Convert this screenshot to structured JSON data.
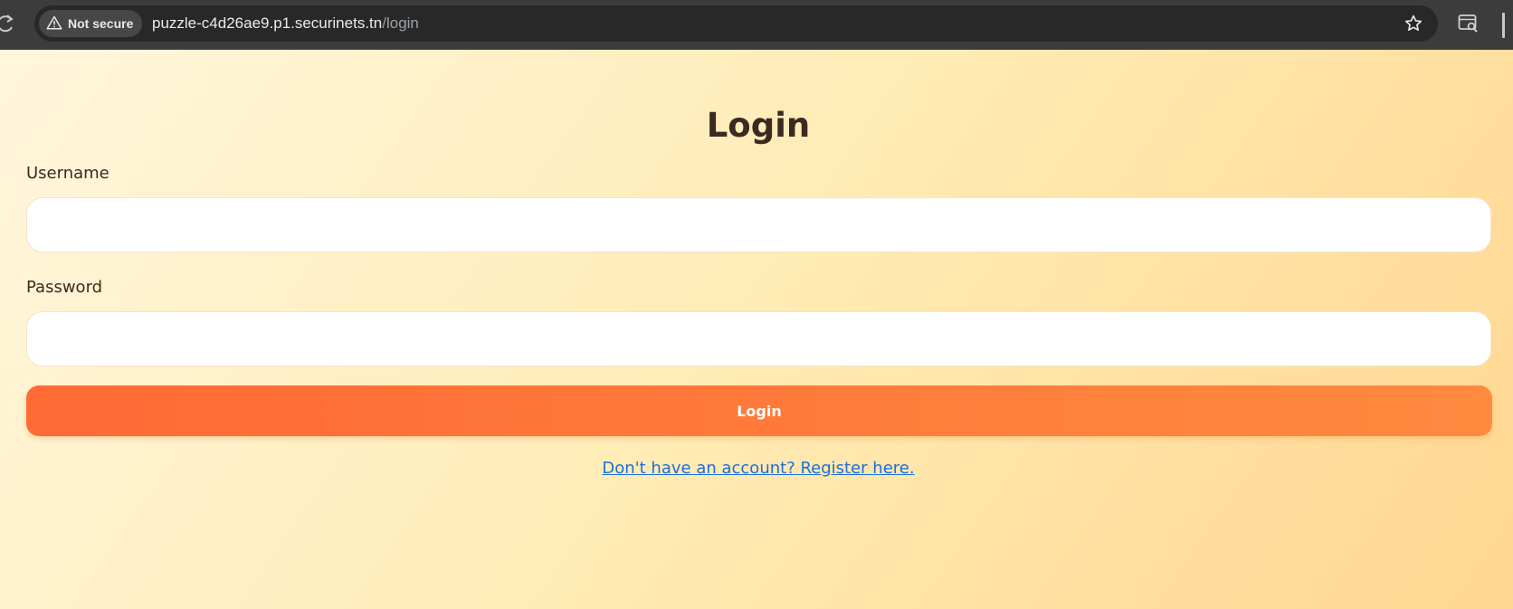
{
  "browser": {
    "security_label": "Not secure",
    "url_host": "puzzle-c4d26ae9.p1.securinets.tn",
    "url_path": "/login",
    "icons": [
      "reload-icon",
      "warning-icon",
      "bookmark-star-icon",
      "side-panel-search-icon"
    ]
  },
  "page": {
    "title": "Login",
    "username_label": "Username",
    "username_value": "",
    "password_label": "Password",
    "password_value": "",
    "login_button_label": "Login",
    "register_link_text": "Don't have an account? Register here."
  },
  "colors": {
    "accent_start": "#ff6a35",
    "accent_end": "#ff8a3e",
    "link": "#1a6fdc",
    "heading": "#3b2a22"
  }
}
